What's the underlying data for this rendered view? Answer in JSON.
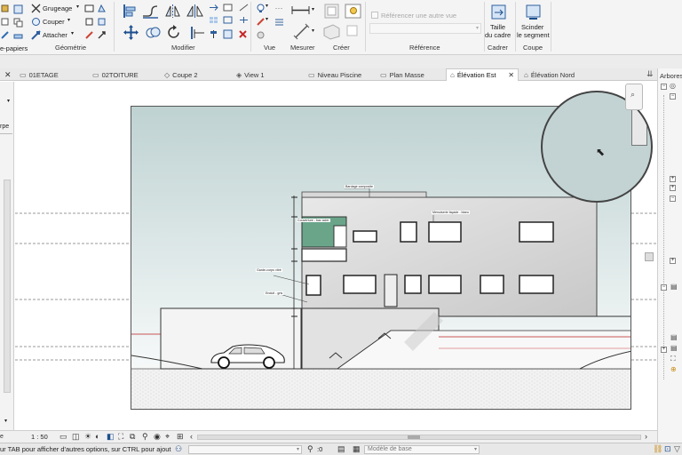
{
  "ribbon": {
    "left_cut_label": "e-papiers",
    "geometrie": {
      "grugeage": "Grugeage",
      "couper": "Couper",
      "attacher": "Attacher",
      "label": "Géométrie"
    },
    "modifier_label": "Modifier",
    "vue_label": "Vue",
    "mesurer_label": "Mesurer",
    "creer_label": "Créer",
    "reference": {
      "checkbox_label": "Référencer une autre vue",
      "label": "Référence"
    },
    "cadrer": {
      "button_line1": "Taille",
      "button_line2": "du cadre",
      "label": "Cadrer"
    },
    "coupe": {
      "button_line1": "Scinder",
      "button_line2": "le segment",
      "label": "Coupe"
    }
  },
  "tabs": [
    {
      "label": "01ETAGE",
      "icon": "floor-plan-icon"
    },
    {
      "label": "02TOITURE",
      "icon": "floor-plan-icon"
    },
    {
      "label": "Coupe 2",
      "icon": "section-icon"
    },
    {
      "label": "View 1",
      "icon": "3d-view-icon"
    },
    {
      "label": "Niveau Piscine",
      "icon": "floor-plan-icon"
    },
    {
      "label": "Plan Masse",
      "icon": "floor-plan-icon"
    },
    {
      "label": "Élévation Est",
      "icon": "elevation-icon",
      "active": true
    },
    {
      "label": "Élévation Nord",
      "icon": "elevation-icon"
    }
  ],
  "left_panel": {
    "cut_label": "rpe"
  },
  "right_panel": {
    "title": "Arbores"
  },
  "drawing": {
    "annotations": [
      "Bardage composite",
      "Menuiserie façade - blanc",
      "Garde-corps vitré",
      "Enduit - gris",
      "Couverture - bac acier"
    ]
  },
  "view_control": {
    "scale": "1 : 50"
  },
  "status": {
    "hint": "ur TAB pour afficher d'autres options, sur CTRL pour ajout",
    "workset_count": ":0",
    "model_dropdown": "Modèle de base"
  }
}
